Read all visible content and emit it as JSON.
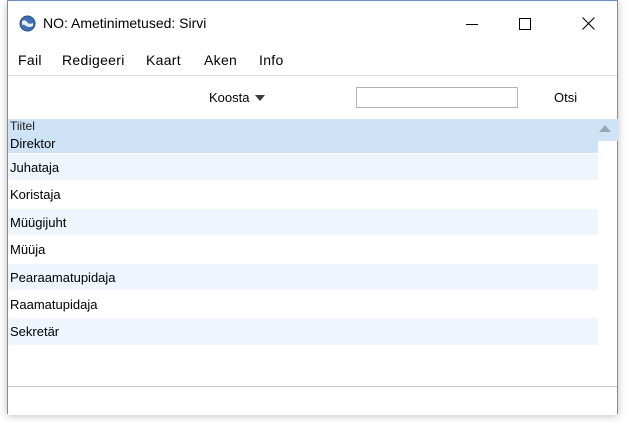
{
  "window": {
    "title": "NO: Ametinimetused: Sirvi"
  },
  "menu": {
    "items": [
      "Fail",
      "Redigeeri",
      "Kaart",
      "Aken",
      "Info"
    ]
  },
  "toolbar": {
    "sort_label": "Koosta",
    "search_value": "",
    "search_button": "Otsi"
  },
  "list": {
    "header": "Tiitel",
    "rows": [
      "Direktor",
      "Juhataja",
      "Koristaja",
      "Müügijuht",
      "Müüja",
      "Pearaamatupidaja",
      "Raamatupidaja",
      "Sekretär"
    ],
    "selected_index": 0
  },
  "colors": {
    "selection": "#cfe3f7",
    "alt_row": "#eef5fc",
    "window_border": "#6d8fbf"
  },
  "icons": {
    "app": "app-globe-icon",
    "minimize": "minimize-icon",
    "maximize": "maximize-icon",
    "close": "close-icon",
    "sort": "chevron-down-icon",
    "scroll_up": "scroll-up-arrow-icon"
  }
}
